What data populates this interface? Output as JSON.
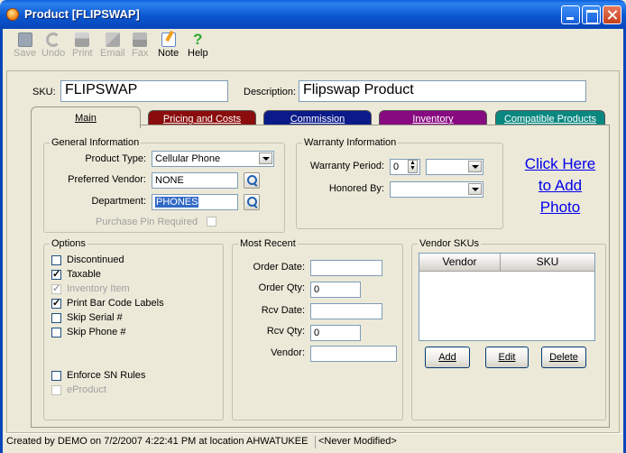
{
  "window": {
    "title": "Product [FLIPSWAP]"
  },
  "toolbar": {
    "items": [
      {
        "label": "Save",
        "icon": "save-icon",
        "enabled": false
      },
      {
        "label": "Undo",
        "icon": "undo-icon",
        "enabled": false
      },
      {
        "label": "Print",
        "icon": "print-icon",
        "enabled": false
      },
      {
        "label": "Email",
        "icon": "email-icon",
        "enabled": false
      },
      {
        "label": "Fax",
        "icon": "fax-icon",
        "enabled": false
      },
      {
        "label": "Note",
        "icon": "note-icon",
        "enabled": true
      },
      {
        "label": "Help",
        "icon": "help-icon",
        "enabled": true
      }
    ]
  },
  "header": {
    "sku_label": "SKU:",
    "sku_value": "FLIPSWAP",
    "description_label": "Description:",
    "description_value": "Flipswap Product"
  },
  "tabs": [
    {
      "label": "Main",
      "active": true,
      "color": "#ECE9D8"
    },
    {
      "label": "Pricing and Costs",
      "active": false,
      "color": "#8A0C0C"
    },
    {
      "label": "Commission",
      "active": false,
      "color": "#0A1A88"
    },
    {
      "label": "Inventory",
      "active": false,
      "color": "#880A80"
    },
    {
      "label": "Compatible Products",
      "active": false,
      "color": "#0A8880"
    }
  ],
  "general": {
    "title": "General Information",
    "product_type_label": "Product Type:",
    "product_type_value": "Cellular Phone",
    "preferred_vendor_label": "Preferred Vendor:",
    "preferred_vendor_value": "NONE",
    "department_label": "Department:",
    "department_value": "PHONES",
    "purchase_pin_label": "Purchase Pin Required"
  },
  "warranty": {
    "title": "Warranty Information",
    "period_label": "Warranty Period:",
    "period_value": "0",
    "honored_by_label": "Honored By:"
  },
  "photo": {
    "line1": "Click Here",
    "line2": "to Add",
    "line3": "Photo"
  },
  "options": {
    "title": "Options",
    "items": [
      {
        "label": "Discontinued",
        "checked": false,
        "enabled": true
      },
      {
        "label": "Taxable",
        "checked": true,
        "enabled": true
      },
      {
        "label": "Inventory Item",
        "checked": true,
        "enabled": false
      },
      {
        "label": "Print Bar Code Labels",
        "checked": true,
        "enabled": true
      },
      {
        "label": "Skip Serial #",
        "checked": false,
        "enabled": true
      },
      {
        "label": "Skip Phone #",
        "checked": false,
        "enabled": true
      },
      {
        "label": "Enforce SN Rules",
        "checked": false,
        "enabled": true
      },
      {
        "label": "eProduct",
        "checked": false,
        "enabled": false
      }
    ]
  },
  "recent": {
    "title": "Most Recent",
    "order_date_label": "Order Date:",
    "order_date_value": "",
    "order_qty_label": "Order Qty:",
    "order_qty_value": "0",
    "rcv_date_label": "Rcv Date:",
    "rcv_date_value": "",
    "rcv_qty_label": "Rcv Qty:",
    "rcv_qty_value": "0",
    "vendor_label": "Vendor:",
    "vendor_value": ""
  },
  "vendor_skus": {
    "title": "Vendor SKUs",
    "columns": [
      "Vendor",
      "SKU"
    ],
    "add_label": "Add",
    "edit_label": "Edit",
    "delete_label": "Delete"
  },
  "status": {
    "created": "Created by DEMO on 7/2/2007 4:22:41 PM at location AHWATUKEE",
    "modified": "<Never Modified>"
  }
}
